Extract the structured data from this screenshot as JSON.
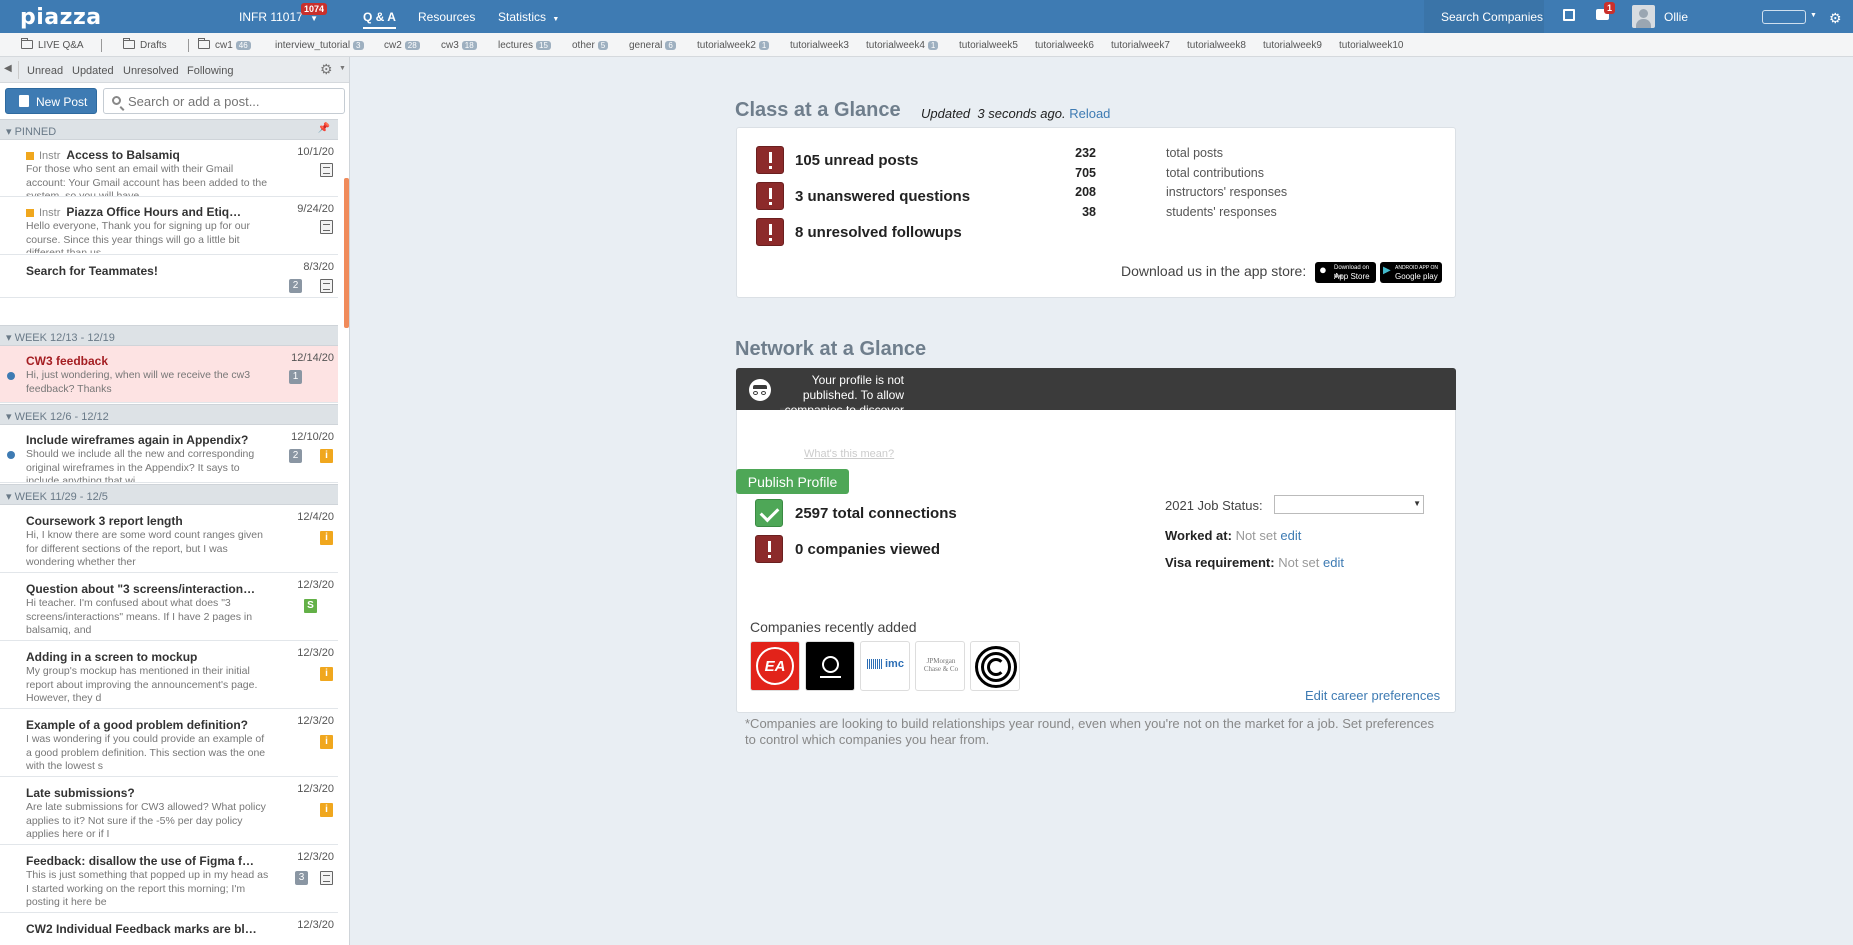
{
  "topbar": {
    "logo": "piazza",
    "class_name": "INFR 11017",
    "class_badge": "1074",
    "nav_qa": "Q & A",
    "nav_resources": "Resources",
    "nav_statistics": "Statistics",
    "search_companies": "Search Companies",
    "messages_badge": "1",
    "user_name": "Ollie"
  },
  "folders": [
    {
      "label": "LIVE Q&A",
      "count": ""
    },
    {
      "label": "Drafts",
      "count": ""
    },
    {
      "label": "cw1",
      "count": "46"
    },
    {
      "label": "interview_tutorial",
      "count": "3"
    },
    {
      "label": "cw2",
      "count": "28"
    },
    {
      "label": "cw3",
      "count": "18"
    },
    {
      "label": "lectures",
      "count": "15"
    },
    {
      "label": "other",
      "count": "5"
    },
    {
      "label": "general",
      "count": "6"
    },
    {
      "label": "tutorialweek2",
      "count": "1"
    },
    {
      "label": "tutorialweek3",
      "count": ""
    },
    {
      "label": "tutorialweek4",
      "count": "1"
    },
    {
      "label": "tutorialweek5",
      "count": ""
    },
    {
      "label": "tutorialweek6",
      "count": ""
    },
    {
      "label": "tutorialweek7",
      "count": ""
    },
    {
      "label": "tutorialweek8",
      "count": ""
    },
    {
      "label": "tutorialweek9",
      "count": ""
    },
    {
      "label": "tutorialweek10",
      "count": ""
    }
  ],
  "filters": {
    "unread": "Unread",
    "updated": "Updated",
    "unresolved": "Unresolved",
    "following": "Following"
  },
  "new_post": "New Post",
  "search": {
    "placeholder": "Search or add a post..."
  },
  "groups": {
    "pinned": "▾ PINNED",
    "week1": "▾ WEEK 12/13 - 12/19",
    "week2": "▾ WEEK 12/6 - 12/12",
    "week3": "▾ WEEK 11/29 - 12/5"
  },
  "posts": [
    {
      "instr": "Instr",
      "title": "Access to Balsamiq",
      "date": "10/1/20",
      "snippet": "For those who sent an email with their Gmail account: Your Gmail account has been added to the system, so you will have"
    },
    {
      "instr": "Instr",
      "title": "Piazza Office Hours and Etiq…",
      "date": "9/24/20",
      "snippet": "Hello everyone,  Thank you for signing up for our course. Since this year things will go a little bit different than us"
    },
    {
      "title": "Search for Teammates!",
      "date": "8/3/20",
      "count": "2"
    },
    {
      "title": "CW3 feedback",
      "date": "12/14/20",
      "snippet": "Hi, just wondering, when will we receive the cw3 feedback? Thanks",
      "count": "1"
    },
    {
      "title": "Include wireframes again in Appendix?",
      "date": "12/10/20",
      "snippet": "Should we include all the new and corresponding original wireframes in the Appendix? It says to include anything that wi",
      "count": "2"
    },
    {
      "title": "Coursework 3 report length",
      "date": "12/4/20",
      "snippet": "Hi, I know there are some word count ranges given for different sections of the report, but I was wondering whether ther"
    },
    {
      "title": "Question about \"3 screens/interaction…",
      "date": "12/3/20",
      "snippet": "Hi teacher. I'm confused about what does \"3 screens/interactions\" means. If I have 2 pages in balsamiq, and"
    },
    {
      "title": "Adding in a screen to mockup",
      "date": "12/3/20",
      "snippet": "My group's mockup has mentioned in their initial report about improving the announcement's page. However, they d"
    },
    {
      "title": "Example of a good problem definition?",
      "date": "12/3/20",
      "snippet": "I was wondering if you could provide an example of a good problem definition. This section was the one with the lowest s"
    },
    {
      "title": "Late submissions?",
      "date": "12/3/20",
      "snippet": "Are late submissions for CW3 allowed? What policy applies to it? Not sure if the -5% per day policy applies here or if I"
    },
    {
      "title": "Feedback: disallow the use of Figma f…",
      "date": "12/3/20",
      "snippet": "This is just something that popped up in my head as I started working on the report this morning; I'm posting it here be",
      "count": "3"
    },
    {
      "title": "CW2 Individual Feedback marks are bl…",
      "date": "12/3/20"
    }
  ],
  "class_glance": {
    "title": "Class at a Glance",
    "updated_prefix": "Updated",
    "updated_time": "3 seconds ago.",
    "reload": "Reload",
    "unread_posts": "105 unread posts",
    "unanswered": "3 unanswered questions",
    "unresolved": "8 unresolved followups",
    "stats": [
      {
        "num": "232",
        "label": "total posts"
      },
      {
        "num": "705",
        "label": "total contributions"
      },
      {
        "num": "208",
        "label": "instructors' responses"
      },
      {
        "num": "38",
        "label": "students' responses"
      }
    ],
    "download": "Download us in the app store:",
    "appstore_small": "Download on the",
    "appstore": "App Store",
    "googleplay_small": "ANDROID APP ON",
    "googleplay": "Google play"
  },
  "network": {
    "title": "Network at a Glance",
    "profile_msg": "Your profile is not published. To allow companies to discover and contact you, publish your profile.",
    "whats_this": "What's this mean?",
    "publish": "Publish Profile",
    "connections": "2597 total connections",
    "companies_viewed": "0 companies viewed",
    "job_status_label": "2021 Job Status:",
    "worked_at_label": "Worked at:",
    "worked_at_value": "Not set",
    "visa_label": "Visa requirement:",
    "visa_value": "Not set",
    "edit": "edit",
    "recently_added": "Companies recently added",
    "company_logos": [
      "EA",
      "O",
      "imc",
      "JPMorgan Chase & Co",
      "O"
    ],
    "edit_career": "Edit career preferences",
    "footnote": "*Companies are looking to build relationships year round, even when you're not on the market for a job. Set preferences to control which companies you hear from."
  }
}
